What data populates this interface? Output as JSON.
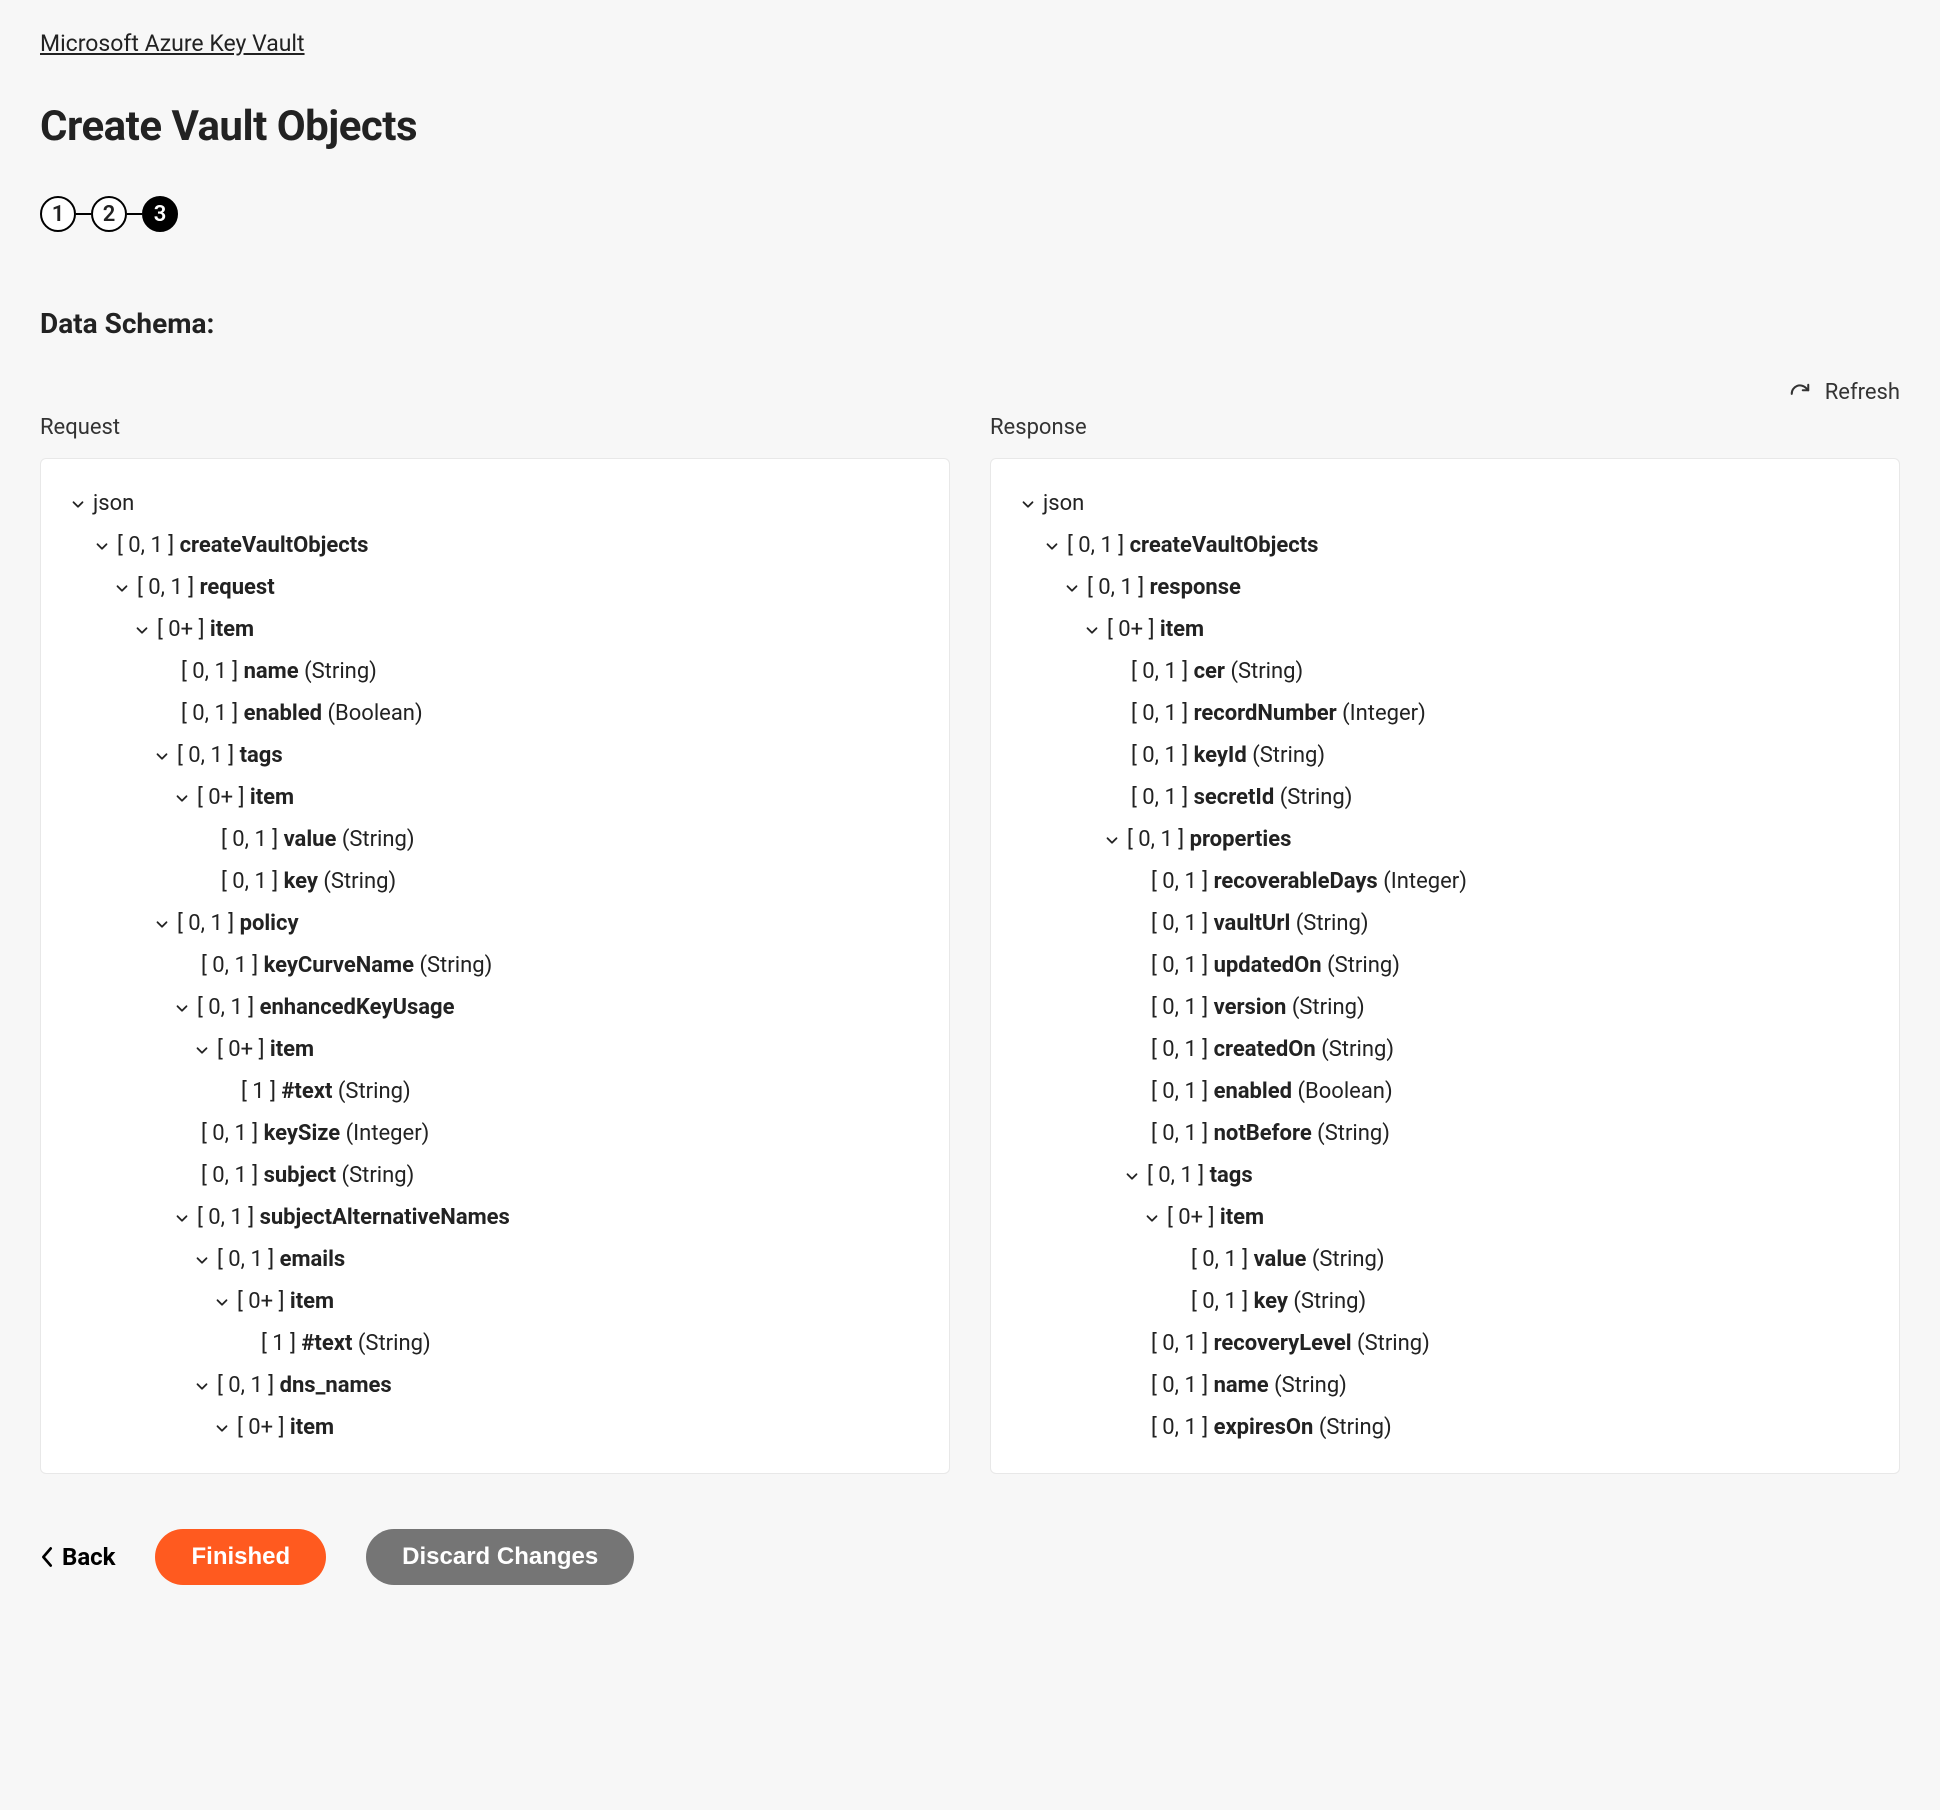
{
  "breadcrumb": "Microsoft Azure Key Vault",
  "page_title": "Create Vault Objects",
  "stepper": {
    "steps": [
      "1",
      "2",
      "3"
    ],
    "active_index": 2
  },
  "section_title": "Data Schema:",
  "refresh_label": "Refresh",
  "request_label": "Request",
  "response_label": "Response",
  "actions": {
    "back": "Back",
    "finished": "Finished",
    "discard": "Discard Changes"
  },
  "request_tree": [
    {
      "depth": 0,
      "expandable": true,
      "card": "",
      "name": "json",
      "name_bold": false,
      "type": ""
    },
    {
      "depth": 1,
      "expandable": true,
      "card": "[ 0, 1 ]",
      "name": "createVaultObjects",
      "name_bold": true,
      "type": ""
    },
    {
      "depth": 2,
      "expandable": true,
      "card": "[ 0, 1 ]",
      "name": "request",
      "name_bold": true,
      "type": ""
    },
    {
      "depth": 3,
      "expandable": true,
      "card": "[ 0+ ]",
      "name": "item",
      "name_bold": true,
      "type": ""
    },
    {
      "depth": 4,
      "expandable": false,
      "card": "[ 0, 1 ]",
      "name": "name",
      "name_bold": true,
      "type": "(String)"
    },
    {
      "depth": 4,
      "expandable": false,
      "card": "[ 0, 1 ]",
      "name": "enabled",
      "name_bold": true,
      "type": "(Boolean)"
    },
    {
      "depth": 4,
      "expandable": true,
      "card": "[ 0, 1 ]",
      "name": "tags",
      "name_bold": true,
      "type": ""
    },
    {
      "depth": 5,
      "expandable": true,
      "card": "[ 0+ ]",
      "name": "item",
      "name_bold": true,
      "type": ""
    },
    {
      "depth": 6,
      "expandable": false,
      "card": "[ 0, 1 ]",
      "name": "value",
      "name_bold": true,
      "type": "(String)"
    },
    {
      "depth": 6,
      "expandable": false,
      "card": "[ 0, 1 ]",
      "name": "key",
      "name_bold": true,
      "type": "(String)"
    },
    {
      "depth": 4,
      "expandable": true,
      "card": "[ 0, 1 ]",
      "name": "policy",
      "name_bold": true,
      "type": ""
    },
    {
      "depth": 5,
      "expandable": false,
      "card": "[ 0, 1 ]",
      "name": "keyCurveName",
      "name_bold": true,
      "type": "(String)"
    },
    {
      "depth": 5,
      "expandable": true,
      "card": "[ 0, 1 ]",
      "name": "enhancedKeyUsage",
      "name_bold": true,
      "type": ""
    },
    {
      "depth": 6,
      "expandable": true,
      "card": "[ 0+ ]",
      "name": "item",
      "name_bold": true,
      "type": ""
    },
    {
      "depth": 7,
      "expandable": false,
      "card": "[ 1 ]",
      "name": "#text",
      "name_bold": true,
      "type": "(String)"
    },
    {
      "depth": 5,
      "expandable": false,
      "card": "[ 0, 1 ]",
      "name": "keySize",
      "name_bold": true,
      "type": "(Integer)"
    },
    {
      "depth": 5,
      "expandable": false,
      "card": "[ 0, 1 ]",
      "name": "subject",
      "name_bold": true,
      "type": "(String)"
    },
    {
      "depth": 5,
      "expandable": true,
      "card": "[ 0, 1 ]",
      "name": "subjectAlternativeNames",
      "name_bold": true,
      "type": ""
    },
    {
      "depth": 6,
      "expandable": true,
      "card": "[ 0, 1 ]",
      "name": "emails",
      "name_bold": true,
      "type": ""
    },
    {
      "depth": 7,
      "expandable": true,
      "card": "[ 0+ ]",
      "name": "item",
      "name_bold": true,
      "type": ""
    },
    {
      "depth": 8,
      "expandable": false,
      "card": "[ 1 ]",
      "name": "#text",
      "name_bold": true,
      "type": "(String)"
    },
    {
      "depth": 6,
      "expandable": true,
      "card": "[ 0, 1 ]",
      "name": "dns_names",
      "name_bold": true,
      "type": ""
    },
    {
      "depth": 7,
      "expandable": true,
      "card": "[ 0+ ]",
      "name": "item",
      "name_bold": true,
      "type": ""
    }
  ],
  "response_tree": [
    {
      "depth": 0,
      "expandable": true,
      "card": "",
      "name": "json",
      "name_bold": false,
      "type": ""
    },
    {
      "depth": 1,
      "expandable": true,
      "card": "[ 0, 1 ]",
      "name": "createVaultObjects",
      "name_bold": true,
      "type": ""
    },
    {
      "depth": 2,
      "expandable": true,
      "card": "[ 0, 1 ]",
      "name": "response",
      "name_bold": true,
      "type": ""
    },
    {
      "depth": 3,
      "expandable": true,
      "card": "[ 0+ ]",
      "name": "item",
      "name_bold": true,
      "type": ""
    },
    {
      "depth": 4,
      "expandable": false,
      "card": "[ 0, 1 ]",
      "name": "cer",
      "name_bold": true,
      "type": "(String)"
    },
    {
      "depth": 4,
      "expandable": false,
      "card": "[ 0, 1 ]",
      "name": "recordNumber",
      "name_bold": true,
      "type": "(Integer)"
    },
    {
      "depth": 4,
      "expandable": false,
      "card": "[ 0, 1 ]",
      "name": "keyId",
      "name_bold": true,
      "type": "(String)"
    },
    {
      "depth": 4,
      "expandable": false,
      "card": "[ 0, 1 ]",
      "name": "secretId",
      "name_bold": true,
      "type": "(String)"
    },
    {
      "depth": 4,
      "expandable": true,
      "card": "[ 0, 1 ]",
      "name": "properties",
      "name_bold": true,
      "type": ""
    },
    {
      "depth": 5,
      "expandable": false,
      "card": "[ 0, 1 ]",
      "name": "recoverableDays",
      "name_bold": true,
      "type": "(Integer)"
    },
    {
      "depth": 5,
      "expandable": false,
      "card": "[ 0, 1 ]",
      "name": "vaultUrl",
      "name_bold": true,
      "type": "(String)"
    },
    {
      "depth": 5,
      "expandable": false,
      "card": "[ 0, 1 ]",
      "name": "updatedOn",
      "name_bold": true,
      "type": "(String)"
    },
    {
      "depth": 5,
      "expandable": false,
      "card": "[ 0, 1 ]",
      "name": "version",
      "name_bold": true,
      "type": "(String)"
    },
    {
      "depth": 5,
      "expandable": false,
      "card": "[ 0, 1 ]",
      "name": "createdOn",
      "name_bold": true,
      "type": "(String)"
    },
    {
      "depth": 5,
      "expandable": false,
      "card": "[ 0, 1 ]",
      "name": "enabled",
      "name_bold": true,
      "type": "(Boolean)"
    },
    {
      "depth": 5,
      "expandable": false,
      "card": "[ 0, 1 ]",
      "name": "notBefore",
      "name_bold": true,
      "type": "(String)"
    },
    {
      "depth": 5,
      "expandable": true,
      "card": "[ 0, 1 ]",
      "name": "tags",
      "name_bold": true,
      "type": ""
    },
    {
      "depth": 6,
      "expandable": true,
      "card": "[ 0+ ]",
      "name": "item",
      "name_bold": true,
      "type": ""
    },
    {
      "depth": 7,
      "expandable": false,
      "card": "[ 0, 1 ]",
      "name": "value",
      "name_bold": true,
      "type": "(String)"
    },
    {
      "depth": 7,
      "expandable": false,
      "card": "[ 0, 1 ]",
      "name": "key",
      "name_bold": true,
      "type": "(String)"
    },
    {
      "depth": 5,
      "expandable": false,
      "card": "[ 0, 1 ]",
      "name": "recoveryLevel",
      "name_bold": true,
      "type": "(String)"
    },
    {
      "depth": 5,
      "expandable": false,
      "card": "[ 0, 1 ]",
      "name": "name",
      "name_bold": true,
      "type": "(String)"
    },
    {
      "depth": 5,
      "expandable": false,
      "card": "[ 0, 1 ]",
      "name": "expiresOn",
      "name_bold": true,
      "type": "(String)"
    }
  ]
}
